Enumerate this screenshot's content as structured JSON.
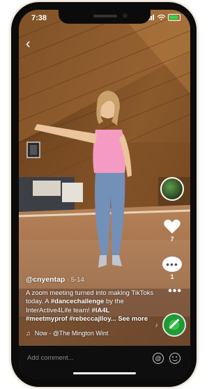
{
  "status": {
    "time": "7:38"
  },
  "nav": {
    "back_icon": "‹"
  },
  "actions": {
    "likes": "7",
    "comments": "1"
  },
  "post": {
    "username": "@cnyentap",
    "date": "5-14",
    "text_1": "A zoom meeting turned into making TikToks today. A ",
    "tag_1": "#dancechallenge",
    "text_2": " by the InterActive4Life team! ",
    "tag_2": "#IA4L",
    "tag_3": "#meetmyprof",
    "tag_4": "#rebeccajlloy...",
    "see_more": "See more",
    "music": "Now - @The Mington Wint"
  },
  "comment_bar": {
    "placeholder": "Add comment...",
    "at_symbol": "@"
  },
  "colors": {
    "accent_green": "#2fd14a",
    "like_white": "#ffffff"
  }
}
